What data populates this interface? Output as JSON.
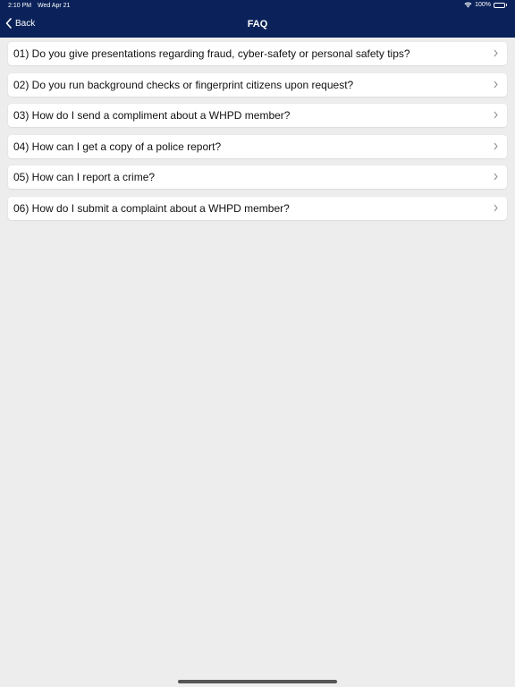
{
  "status_bar": {
    "time": "2:10 PM",
    "date": "Wed Apr 21",
    "battery": "100%",
    "battery_level": 1.0,
    "wifi_icon": "wifi-icon",
    "battery_icon": "battery-icon"
  },
  "nav": {
    "back_label": "Back",
    "back_icon": "chevron-left-icon",
    "title": "FAQ",
    "bar_color": "#0a2259"
  },
  "faq": {
    "items": [
      {
        "label": "01) Do you give presentations regarding fraud, cyber-safety or personal safety tips?"
      },
      {
        "label": "02) Do you run background checks or fingerprint citizens upon request?"
      },
      {
        "label": "03) How do I send a compliment about a WHPD member?"
      },
      {
        "label": "04) How can I get a copy of a police report?"
      },
      {
        "label": "05) How can I report a crime?"
      },
      {
        "label": "06) How do I submit a complaint about a WHPD member?"
      }
    ],
    "row_icon": "chevron-right-icon"
  }
}
